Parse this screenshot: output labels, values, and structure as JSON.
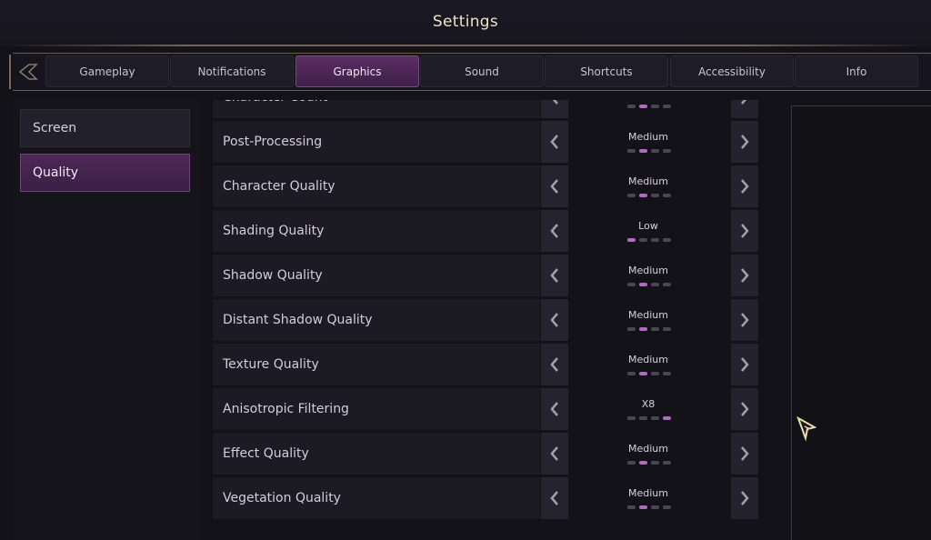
{
  "header": {
    "title": "Settings"
  },
  "tabs": [
    {
      "label": "Gameplay",
      "active": false
    },
    {
      "label": "Notifications",
      "active": false
    },
    {
      "label": "Graphics",
      "active": true
    },
    {
      "label": "Sound",
      "active": false
    },
    {
      "label": "Shortcuts",
      "active": false
    },
    {
      "label": "Accessibility",
      "active": false
    },
    {
      "label": "Info",
      "active": false
    }
  ],
  "sidebar": {
    "items": [
      {
        "label": "Screen",
        "active": false
      },
      {
        "label": "Quality",
        "active": true
      }
    ]
  },
  "settings": [
    {
      "label": "Character Count",
      "value": "",
      "level": 2,
      "levels": 4
    },
    {
      "label": "Post-Processing",
      "value": "Medium",
      "level": 2,
      "levels": 4
    },
    {
      "label": "Character Quality",
      "value": "Medium",
      "level": 2,
      "levels": 4
    },
    {
      "label": "Shading Quality",
      "value": "Low",
      "level": 1,
      "levels": 4
    },
    {
      "label": "Shadow Quality",
      "value": "Medium",
      "level": 2,
      "levels": 4
    },
    {
      "label": "Distant Shadow Quality",
      "value": "Medium",
      "level": 2,
      "levels": 4
    },
    {
      "label": "Texture Quality",
      "value": "Medium",
      "level": 2,
      "levels": 4
    },
    {
      "label": "Anisotropic Filtering",
      "value": "X8",
      "level": 4,
      "levels": 4
    },
    {
      "label": "Effect Quality",
      "value": "Medium",
      "level": 2,
      "levels": 4
    },
    {
      "label": "Vegetation Quality",
      "value": "Medium",
      "level": 2,
      "levels": 4
    }
  ],
  "icons": {
    "back": "back-arrow-icon",
    "prev": "chevron-left-icon",
    "next": "chevron-right-icon",
    "cursor": "cursor-icon"
  },
  "colors": {
    "accent": "#5b2d64",
    "dot_on": "#b06ac2",
    "dot_off": "#4a4752"
  }
}
